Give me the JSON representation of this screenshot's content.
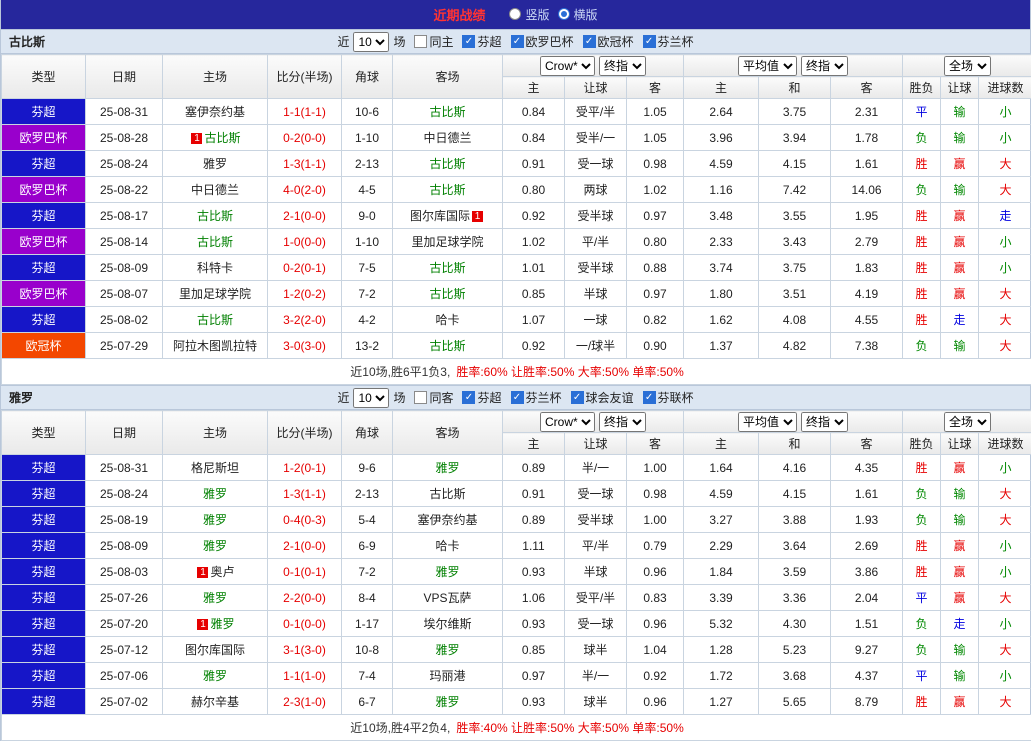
{
  "topbar": {
    "title": "近期战绩",
    "radios": [
      {
        "key": "vertical",
        "label": "竖版",
        "checked": false
      },
      {
        "key": "horizontal",
        "label": "横版",
        "checked": true
      }
    ]
  },
  "table_header": {
    "static_cols": [
      "类型",
      "日期",
      "主场",
      "比分(半场)",
      "角球",
      "客场"
    ],
    "selects": {
      "company": "Crow*",
      "company_odds": "终指",
      "average": "平均值",
      "average_odds": "终指",
      "fullmatch": "全场"
    },
    "sub_cols": [
      "主",
      "让球",
      "客",
      "主",
      "和",
      "客",
      "胜负",
      "让球",
      "进球数"
    ]
  },
  "sections": [
    {
      "team": "古比斯",
      "filter": {
        "prefix": "近",
        "count": "10",
        "suffix": "场",
        "same": {
          "label": "同主",
          "checked": false
        },
        "leagues": [
          {
            "label": "芬超",
            "checked": true
          },
          {
            "label": "欧罗巴杯",
            "checked": true
          },
          {
            "label": "欧冠杯",
            "checked": true
          },
          {
            "label": "芬兰杯",
            "checked": true
          }
        ]
      },
      "rows": [
        {
          "league": "芬超",
          "date": "25-08-31",
          "home": {
            "name": "塞伊奈约基",
            "hl": false,
            "badge": ""
          },
          "score": "1-1(1-1)",
          "corner": "10-6",
          "away": {
            "name": "古比斯",
            "hl": true,
            "badge": ""
          },
          "crown": [
            "0.84",
            "受平/半",
            "1.05"
          ],
          "avg": [
            "2.64",
            "3.75",
            "2.31"
          ],
          "results": [
            {
              "text": "平",
              "type": "push"
            },
            {
              "text": "输",
              "type": "loss"
            },
            {
              "text": "小",
              "type": "loss"
            }
          ]
        },
        {
          "league": "欧罗巴杯",
          "date": "25-08-28",
          "home": {
            "name": "古比斯",
            "hl": true,
            "badge": "before"
          },
          "score": "0-2(0-0)",
          "corner": "1-10",
          "away": {
            "name": "中日德兰",
            "hl": false,
            "badge": ""
          },
          "crown": [
            "0.84",
            "受半/一",
            "1.05"
          ],
          "avg": [
            "3.96",
            "3.94",
            "1.78"
          ],
          "results": [
            {
              "text": "负",
              "type": "loss"
            },
            {
              "text": "输",
              "type": "loss"
            },
            {
              "text": "小",
              "type": "loss"
            }
          ]
        },
        {
          "league": "芬超",
          "date": "25-08-24",
          "home": {
            "name": "雅罗",
            "hl": false,
            "badge": ""
          },
          "score": "1-3(1-1)",
          "corner": "2-13",
          "away": {
            "name": "古比斯",
            "hl": true,
            "badge": ""
          },
          "crown": [
            "0.91",
            "受一球",
            "0.98"
          ],
          "avg": [
            "4.59",
            "4.15",
            "1.61"
          ],
          "results": [
            {
              "text": "胜",
              "type": "win"
            },
            {
              "text": "赢",
              "type": "win"
            },
            {
              "text": "大",
              "type": "win"
            }
          ]
        },
        {
          "league": "欧罗巴杯",
          "date": "25-08-22",
          "home": {
            "name": "中日德兰",
            "hl": false,
            "badge": ""
          },
          "score": "4-0(2-0)",
          "corner": "4-5",
          "away": {
            "name": "古比斯",
            "hl": true,
            "badge": ""
          },
          "crown": [
            "0.80",
            "两球",
            "1.02"
          ],
          "avg": [
            "1.16",
            "7.42",
            "14.06"
          ],
          "results": [
            {
              "text": "负",
              "type": "loss"
            },
            {
              "text": "输",
              "type": "loss"
            },
            {
              "text": "大",
              "type": "win"
            }
          ]
        },
        {
          "league": "芬超",
          "date": "25-08-17",
          "home": {
            "name": "古比斯",
            "hl": true,
            "badge": ""
          },
          "score": "2-1(0-0)",
          "corner": "9-0",
          "away": {
            "name": "图尔库国际",
            "hl": false,
            "badge": "after"
          },
          "crown": [
            "0.92",
            "受半球",
            "0.97"
          ],
          "avg": [
            "3.48",
            "3.55",
            "1.95"
          ],
          "results": [
            {
              "text": "胜",
              "type": "win"
            },
            {
              "text": "赢",
              "type": "win"
            },
            {
              "text": "走",
              "type": "push"
            }
          ]
        },
        {
          "league": "欧罗巴杯",
          "date": "25-08-14",
          "home": {
            "name": "古比斯",
            "hl": true,
            "badge": ""
          },
          "score": "1-0(0-0)",
          "corner": "1-10",
          "away": {
            "name": "里加足球学院",
            "hl": false,
            "badge": ""
          },
          "crown": [
            "1.02",
            "平/半",
            "0.80"
          ],
          "avg": [
            "2.33",
            "3.43",
            "2.79"
          ],
          "results": [
            {
              "text": "胜",
              "type": "win"
            },
            {
              "text": "赢",
              "type": "win"
            },
            {
              "text": "小",
              "type": "loss"
            }
          ]
        },
        {
          "league": "芬超",
          "date": "25-08-09",
          "home": {
            "name": "科特卡",
            "hl": false,
            "badge": ""
          },
          "score": "0-2(0-1)",
          "corner": "7-5",
          "away": {
            "name": "古比斯",
            "hl": true,
            "badge": ""
          },
          "crown": [
            "1.01",
            "受半球",
            "0.88"
          ],
          "avg": [
            "3.74",
            "3.75",
            "1.83"
          ],
          "results": [
            {
              "text": "胜",
              "type": "win"
            },
            {
              "text": "赢",
              "type": "win"
            },
            {
              "text": "小",
              "type": "loss"
            }
          ]
        },
        {
          "league": "欧罗巴杯",
          "date": "25-08-07",
          "home": {
            "name": "里加足球学院",
            "hl": false,
            "badge": ""
          },
          "score": "1-2(0-2)",
          "corner": "7-2",
          "away": {
            "name": "古比斯",
            "hl": true,
            "badge": ""
          },
          "crown": [
            "0.85",
            "半球",
            "0.97"
          ],
          "avg": [
            "1.80",
            "3.51",
            "4.19"
          ],
          "results": [
            {
              "text": "胜",
              "type": "win"
            },
            {
              "text": "赢",
              "type": "win"
            },
            {
              "text": "大",
              "type": "win"
            }
          ]
        },
        {
          "league": "芬超",
          "date": "25-08-02",
          "home": {
            "name": "古比斯",
            "hl": true,
            "badge": ""
          },
          "score": "3-2(2-0)",
          "corner": "4-2",
          "away": {
            "name": "哈卡",
            "hl": false,
            "badge": ""
          },
          "crown": [
            "1.07",
            "一球",
            "0.82"
          ],
          "avg": [
            "1.62",
            "4.08",
            "4.55"
          ],
          "results": [
            {
              "text": "胜",
              "type": "win"
            },
            {
              "text": "走",
              "type": "push"
            },
            {
              "text": "大",
              "type": "win"
            }
          ]
        },
        {
          "league": "欧冠杯",
          "date": "25-07-29",
          "home": {
            "name": "阿拉木图凯拉特",
            "hl": false,
            "badge": ""
          },
          "score": "3-0(3-0)",
          "corner": "13-2",
          "away": {
            "name": "古比斯",
            "hl": true,
            "badge": ""
          },
          "crown": [
            "0.92",
            "一/球半",
            "0.90"
          ],
          "avg": [
            "1.37",
            "4.82",
            "7.38"
          ],
          "results": [
            {
              "text": "负",
              "type": "loss"
            },
            {
              "text": "输",
              "type": "loss"
            },
            {
              "text": "大",
              "type": "win"
            }
          ]
        }
      ],
      "summary": {
        "prefix": "近10场,胜6平1负3,",
        "stats": "胜率:60% 让胜率:50% 大率:50% 单率:50%"
      }
    },
    {
      "team": "雅罗",
      "filter": {
        "prefix": "近",
        "count": "10",
        "suffix": "场",
        "same": {
          "label": "同客",
          "checked": false
        },
        "leagues": [
          {
            "label": "芬超",
            "checked": true
          },
          {
            "label": "芬兰杯",
            "checked": true
          },
          {
            "label": "球会友谊",
            "checked": true
          },
          {
            "label": "芬联杯",
            "checked": true
          }
        ]
      },
      "rows": [
        {
          "league": "芬超",
          "date": "25-08-31",
          "home": {
            "name": "格尼斯坦",
            "hl": false,
            "badge": ""
          },
          "score": "1-2(0-1)",
          "corner": "9-6",
          "away": {
            "name": "雅罗",
            "hl": true,
            "badge": ""
          },
          "crown": [
            "0.89",
            "半/一",
            "1.00"
          ],
          "avg": [
            "1.64",
            "4.16",
            "4.35"
          ],
          "results": [
            {
              "text": "胜",
              "type": "win"
            },
            {
              "text": "赢",
              "type": "win"
            },
            {
              "text": "小",
              "type": "loss"
            }
          ]
        },
        {
          "league": "芬超",
          "date": "25-08-24",
          "home": {
            "name": "雅罗",
            "hl": true,
            "badge": ""
          },
          "score": "1-3(1-1)",
          "corner": "2-13",
          "away": {
            "name": "古比斯",
            "hl": false,
            "badge": ""
          },
          "crown": [
            "0.91",
            "受一球",
            "0.98"
          ],
          "avg": [
            "4.59",
            "4.15",
            "1.61"
          ],
          "results": [
            {
              "text": "负",
              "type": "loss"
            },
            {
              "text": "输",
              "type": "loss"
            },
            {
              "text": "大",
              "type": "win"
            }
          ]
        },
        {
          "league": "芬超",
          "date": "25-08-19",
          "home": {
            "name": "雅罗",
            "hl": true,
            "badge": ""
          },
          "score": "0-4(0-3)",
          "corner": "5-4",
          "away": {
            "name": "塞伊奈约基",
            "hl": false,
            "badge": ""
          },
          "crown": [
            "0.89",
            "受半球",
            "1.00"
          ],
          "avg": [
            "3.27",
            "3.88",
            "1.93"
          ],
          "results": [
            {
              "text": "负",
              "type": "loss"
            },
            {
              "text": "输",
              "type": "loss"
            },
            {
              "text": "大",
              "type": "win"
            }
          ]
        },
        {
          "league": "芬超",
          "date": "25-08-09",
          "home": {
            "name": "雅罗",
            "hl": true,
            "badge": ""
          },
          "score": "2-1(0-0)",
          "corner": "6-9",
          "away": {
            "name": "哈卡",
            "hl": false,
            "badge": ""
          },
          "crown": [
            "1.11",
            "平/半",
            "0.79"
          ],
          "avg": [
            "2.29",
            "3.64",
            "2.69"
          ],
          "results": [
            {
              "text": "胜",
              "type": "win"
            },
            {
              "text": "赢",
              "type": "win"
            },
            {
              "text": "小",
              "type": "loss"
            }
          ]
        },
        {
          "league": "芬超",
          "date": "25-08-03",
          "home": {
            "name": "奥卢",
            "hl": false,
            "badge": "before"
          },
          "score": "0-1(0-1)",
          "corner": "7-2",
          "away": {
            "name": "雅罗",
            "hl": true,
            "badge": ""
          },
          "crown": [
            "0.93",
            "半球",
            "0.96"
          ],
          "avg": [
            "1.84",
            "3.59",
            "3.86"
          ],
          "results": [
            {
              "text": "胜",
              "type": "win"
            },
            {
              "text": "赢",
              "type": "win"
            },
            {
              "text": "小",
              "type": "loss"
            }
          ]
        },
        {
          "league": "芬超",
          "date": "25-07-26",
          "home": {
            "name": "雅罗",
            "hl": true,
            "badge": ""
          },
          "score": "2-2(0-0)",
          "corner": "8-4",
          "away": {
            "name": "VPS瓦萨",
            "hl": false,
            "badge": ""
          },
          "crown": [
            "1.06",
            "受平/半",
            "0.83"
          ],
          "avg": [
            "3.39",
            "3.36",
            "2.04"
          ],
          "results": [
            {
              "text": "平",
              "type": "push"
            },
            {
              "text": "赢",
              "type": "win"
            },
            {
              "text": "大",
              "type": "win"
            }
          ]
        },
        {
          "league": "芬超",
          "date": "25-07-20",
          "home": {
            "name": "雅罗",
            "hl": true,
            "badge": "before"
          },
          "score": "0-1(0-0)",
          "corner": "1-17",
          "away": {
            "name": "埃尔维斯",
            "hl": false,
            "badge": ""
          },
          "crown": [
            "0.93",
            "受一球",
            "0.96"
          ],
          "avg": [
            "5.32",
            "4.30",
            "1.51"
          ],
          "results": [
            {
              "text": "负",
              "type": "loss"
            },
            {
              "text": "走",
              "type": "push"
            },
            {
              "text": "小",
              "type": "loss"
            }
          ]
        },
        {
          "league": "芬超",
          "date": "25-07-12",
          "home": {
            "name": "图尔库国际",
            "hl": false,
            "badge": ""
          },
          "score": "3-1(3-0)",
          "corner": "10-8",
          "away": {
            "name": "雅罗",
            "hl": true,
            "badge": ""
          },
          "crown": [
            "0.85",
            "球半",
            "1.04"
          ],
          "avg": [
            "1.28",
            "5.23",
            "9.27"
          ],
          "results": [
            {
              "text": "负",
              "type": "loss"
            },
            {
              "text": "输",
              "type": "loss"
            },
            {
              "text": "大",
              "type": "win"
            }
          ]
        },
        {
          "league": "芬超",
          "date": "25-07-06",
          "home": {
            "name": "雅罗",
            "hl": true,
            "badge": ""
          },
          "score": "1-1(1-0)",
          "corner": "7-4",
          "away": {
            "name": "玛丽港",
            "hl": false,
            "badge": ""
          },
          "crown": [
            "0.97",
            "半/一",
            "0.92"
          ],
          "avg": [
            "1.72",
            "3.68",
            "4.37"
          ],
          "results": [
            {
              "text": "平",
              "type": "push"
            },
            {
              "text": "输",
              "type": "loss"
            },
            {
              "text": "小",
              "type": "loss"
            }
          ]
        },
        {
          "league": "芬超",
          "date": "25-07-02",
          "home": {
            "name": "赫尔辛基",
            "hl": false,
            "badge": ""
          },
          "score": "2-3(1-0)",
          "corner": "6-7",
          "away": {
            "name": "雅罗",
            "hl": true,
            "badge": ""
          },
          "crown": [
            "0.93",
            "球半",
            "0.96"
          ],
          "avg": [
            "1.27",
            "5.65",
            "8.79"
          ],
          "results": [
            {
              "text": "胜",
              "type": "win"
            },
            {
              "text": "赢",
              "type": "win"
            },
            {
              "text": "大",
              "type": "win"
            }
          ]
        }
      ],
      "summary": {
        "prefix": "近10场,胜4平2负4,",
        "stats": "胜率:40% 让胜率:50% 大率:50% 单率:50%"
      }
    }
  ],
  "colors": {
    "accent": "#2a6fd6",
    "score": "#e60000",
    "team_highlight": "#008000",
    "league": {
      "芬超": "#1616c8",
      "欧罗巴杯": "#9900cc",
      "欧冠杯": "#f34700"
    },
    "result": {
      "win": "#e60000",
      "push": "#0000e0",
      "loss": "#008800"
    }
  }
}
